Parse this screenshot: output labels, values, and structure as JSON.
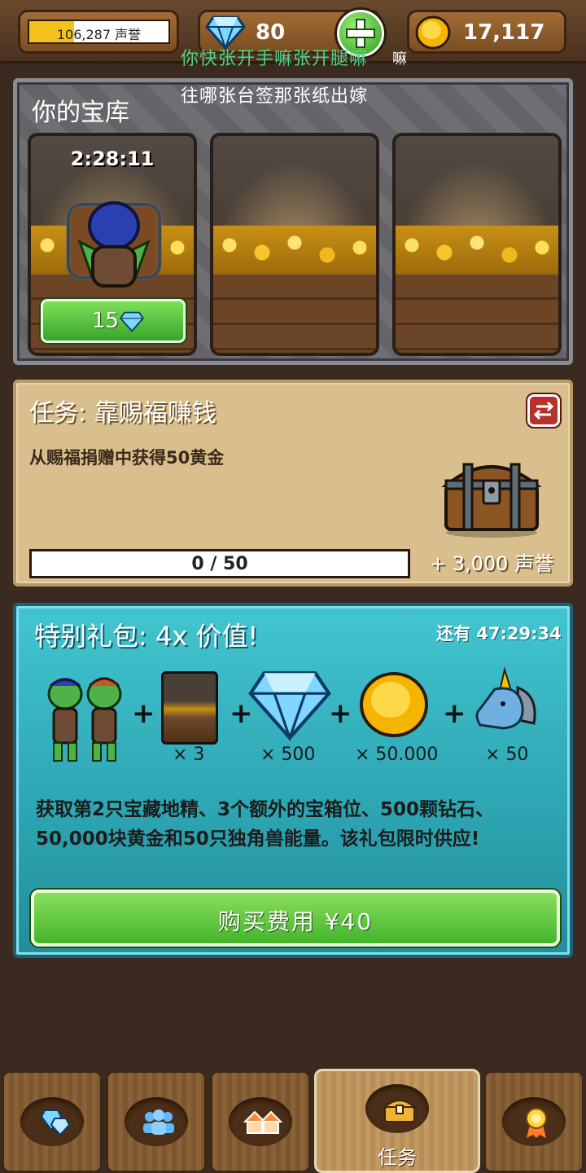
{
  "topbar": {
    "fame_value": "106,287 声誉",
    "fame_progress_fraction": 0.32,
    "gems": "80",
    "gold": "17,117"
  },
  "overlay": {
    "line1": "你快张开手嘛张开腿嘛",
    "line1_tail": "嘛",
    "line2": "往哪张台签那张纸出嫁"
  },
  "vault": {
    "title": "你的宝库",
    "slots": [
      {
        "timer": "2:28:11",
        "speedup_cost": "15"
      },
      {},
      {}
    ]
  },
  "quest": {
    "title": "任务: 靠赐福赚钱",
    "description": "从赐福捐赠中获得50黄金",
    "progress_text": "0 / 50",
    "progress_fraction": 0.0,
    "reward": "+ 3,000 声誉"
  },
  "offer": {
    "title": "特别礼包:  4x 价值!",
    "timer": "还有 47:29:34",
    "items": [
      {
        "icon": "goblins-icon",
        "qty": ""
      },
      {
        "icon": "vault-slot-icon",
        "qty": "× 3"
      },
      {
        "icon": "diamond-icon",
        "qty": "× 500"
      },
      {
        "icon": "gold-coin-icon",
        "qty": "× 50.000"
      },
      {
        "icon": "unicorn-icon",
        "qty": "× 50"
      }
    ],
    "description": "获取第2只宝藏地精、3个额外的宝箱位、500颗钻石、50,000块黄金和50只独角兽能量。该礼包限时供应!",
    "buy_label": "购买费用 ¥40"
  },
  "nav": {
    "tabs": [
      {
        "icon": "gems-icon",
        "label": ""
      },
      {
        "icon": "people-icon",
        "label": ""
      },
      {
        "icon": "houses-icon",
        "label": ""
      },
      {
        "icon": "treasure-chest-icon",
        "label": "任务"
      },
      {
        "icon": "medal-icon",
        "label": ""
      }
    ],
    "active_index": 3
  },
  "colors": {
    "wood": "#7a4d22",
    "quest_bg": "#d9bf8e",
    "offer_bg": "#2ea7b4",
    "button_green": "#44b32c",
    "gold": "#f2c21a"
  }
}
